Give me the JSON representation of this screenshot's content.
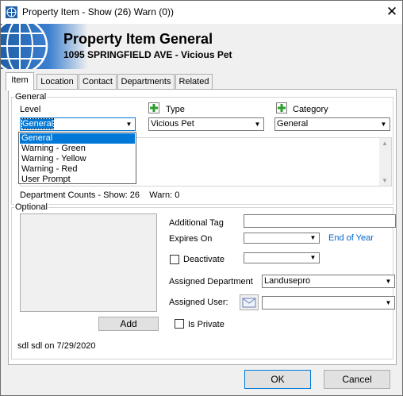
{
  "window": {
    "title": "Property Item - Show (26) Warn (0))"
  },
  "banner": {
    "title": "Property Item General",
    "subtitle": "1095 SPRINGFIELD AVE - Vicious Pet"
  },
  "tabs": [
    {
      "label": "Item",
      "active": true
    },
    {
      "label": "Location",
      "active": false
    },
    {
      "label": "Contact",
      "active": false
    },
    {
      "label": "Departments",
      "active": false
    },
    {
      "label": "Related",
      "active": false
    }
  ],
  "general": {
    "group_label": "General",
    "level_label": "Level",
    "level_value": "General",
    "type_label": "Type",
    "type_value": "Vicious Pet",
    "category_label": "Category",
    "category_value": "General",
    "department_counts": "Department Counts - Show: 26    Warn: 0",
    "level_options": [
      "General",
      "Warning - Green",
      "Warning - Yellow",
      "Warning - Red",
      "User Prompt"
    ],
    "level_selected_index": 0
  },
  "optional": {
    "group_label": "Optional",
    "add_button": "Add",
    "additional_tag_label": "Additional Tag",
    "additional_tag_value": "",
    "expires_on_label": "Expires On",
    "expires_on_value": "",
    "end_of_year_link": "End of Year",
    "deactivate_label": "Deactivate",
    "deactivate_checked": false,
    "assigned_department_label": "Assigned Department",
    "assigned_department_value": "Landusepro",
    "assigned_user_label": "Assigned User:",
    "assigned_user_value": "",
    "is_private_label": "Is Private",
    "is_private_checked": false,
    "audit_text": "sdl sdl on 7/29/2020"
  },
  "buttons": {
    "ok": "OK",
    "cancel": "Cancel"
  },
  "colors": {
    "selection": "#0078d7",
    "link": "#0066cc",
    "add_green": "#2f9e2f",
    "globe_blue": "#1f5fa8"
  }
}
